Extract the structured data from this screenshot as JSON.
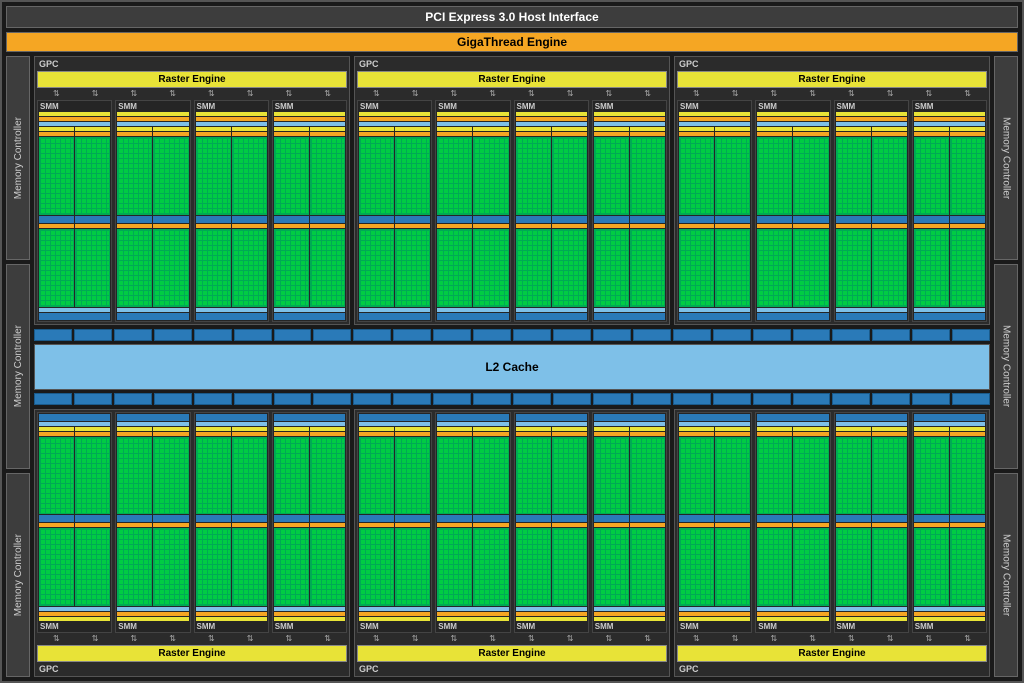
{
  "pci_label": "PCI Express 3.0 Host Interface",
  "gigathread_label": "GigaThread Engine",
  "mem_controller_label": "Memory Controller",
  "gpc_label": "GPC",
  "raster_label": "Raster Engine",
  "smm_label": "SMM",
  "l2_label": "L2 Cache",
  "layout": {
    "mem_controllers_per_side": 3,
    "gpc_rows": 2,
    "gpcs_per_row": 3,
    "smms_per_gpc": 4,
    "l2_strip_segments": 24
  },
  "colors": {
    "background": "#1a1a1a",
    "pci_bg": "#3d3d3d",
    "gigathread_bg": "#f5a623",
    "raster_bg": "#e8e337",
    "core_green": "#0c4",
    "l2_blue": "#7ec0e8",
    "mem_blue": "#2a7ab8",
    "orange": "#f5a623"
  }
}
